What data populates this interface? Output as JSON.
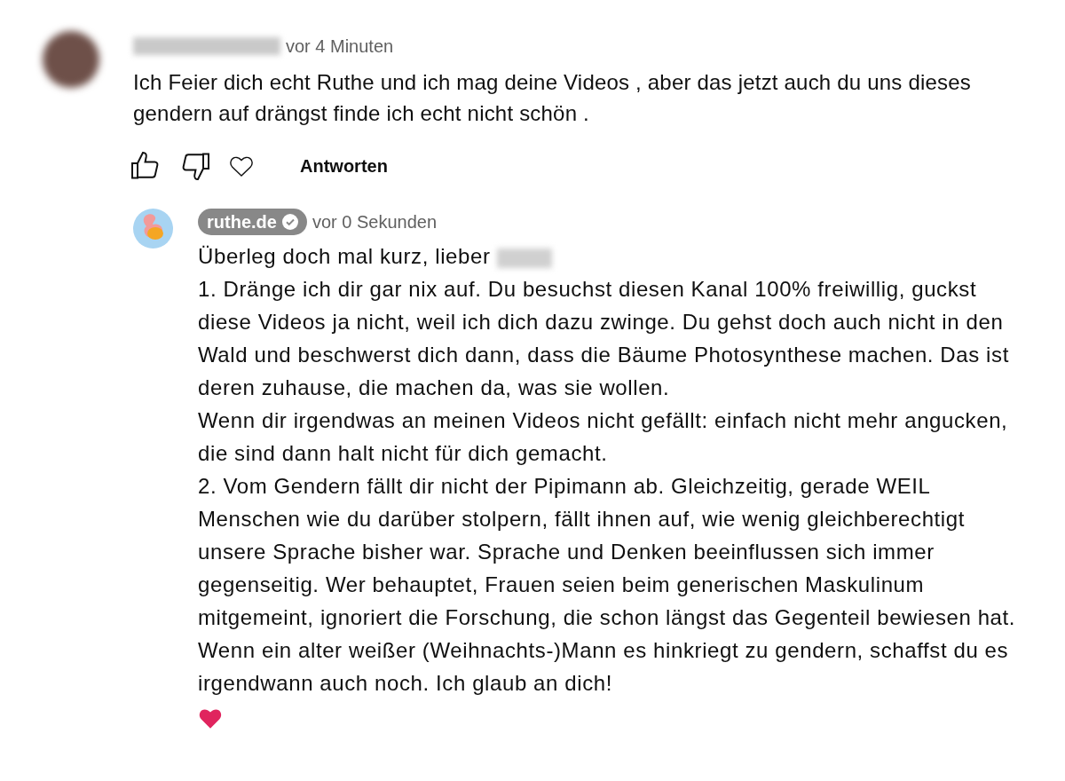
{
  "comment": {
    "time": "vor 4 Minuten",
    "text": "Ich Feier dich echt Ruthe und ich mag deine Videos , aber das jetzt auch du uns dieses gendern auf drängst finde ich echt nicht schön .",
    "reply_button": "Antworten"
  },
  "reply": {
    "author": "ruthe.de",
    "verified": true,
    "time": "vor 0 Sekunden",
    "paragraphs": [
      {
        "kind": "greeting",
        "text": "Überleg doch mal kurz, lieber"
      },
      {
        "kind": "text",
        "text": "1. Dränge ich dir gar nix auf. Du besuchst diesen Kanal 100% freiwillig, guckst diese Videos ja nicht, weil ich dich dazu zwinge. Du gehst doch auch nicht in den Wald und beschwerst dich dann, dass die Bäume Photosynthese machen. Das ist deren zuhause, die machen da, was sie wollen."
      },
      {
        "kind": "text",
        "text": "Wenn dir irgendwas an meinen Videos nicht gefällt: einfach nicht mehr angucken, die sind dann halt nicht für dich gemacht."
      },
      {
        "kind": "text",
        "text": "2. Vom Gendern fällt dir nicht der Pipimann ab. Gleichzeitig, gerade WEIL Menschen wie du darüber stolpern, fällt ihnen auf, wie wenig gleichberechtigt unsere Sprache bisher war. Sprache und Denken beeinflussen sich immer gegenseitig. Wer behauptet, Frauen seien beim generischen Maskulinum mitgemeint, ignoriert die Forschung, die schon längst das Gegenteil bewiesen hat."
      },
      {
        "kind": "text",
        "text": "Wenn ein alter weißer (Weihnachts-)Mann es hinkriegt zu gendern, schaffst du es irgendwann auch noch.  Ich glaub an dich!"
      },
      {
        "kind": "heart"
      }
    ]
  }
}
